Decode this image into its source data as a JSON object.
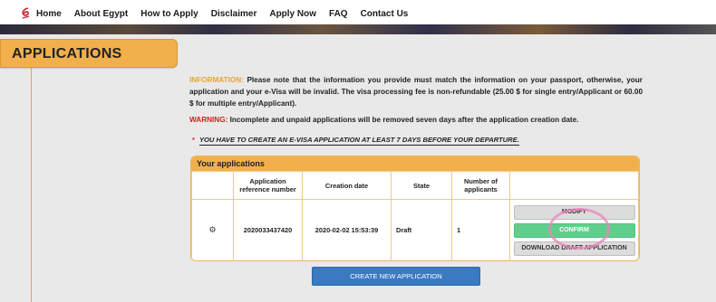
{
  "nav": {
    "items": [
      "Home",
      "About Egypt",
      "How to Apply",
      "Disclaimer",
      "Apply Now",
      "FAQ",
      "Contact Us"
    ]
  },
  "page": {
    "title": "APPLICATIONS"
  },
  "info": {
    "label": "INFORMATION:",
    "text": "Please note that the information you provide must match the information on your passport, otherwise, your application and your e-Visa will be invalid. The visa processing fee is non-refundable (25.00 $ for single entry/Applicant or 60.00 $ for multiple entry/Applicant)."
  },
  "warning": {
    "label": "WARNING:",
    "text": "Incomplete and unpaid applications will be removed seven days after the application creation date."
  },
  "notice": {
    "star": "*",
    "text": "YOU HAVE TO CREATE AN E-VISA APPLICATION AT LEAST 7 DAYS BEFORE YOUR DEPARTURE."
  },
  "panel": {
    "title": "Your applications",
    "columns": [
      "",
      "Application reference number",
      "Creation date",
      "State",
      "Number of applicants",
      ""
    ],
    "rows": [
      {
        "reference": "2020033437420",
        "created": "2020-02-02 15:53:39",
        "state": "Draft",
        "applicants": "1",
        "actions": {
          "top": "MODIFY",
          "confirm": "CONFIRM",
          "download": "DOWNLOAD DRAFT APPLICATION"
        }
      }
    ]
  },
  "create_button": "CREATE NEW APPLICATION",
  "colors": {
    "accent": "#f1b04c",
    "confirm": "#5fd08c",
    "primary": "#3a7ac0",
    "warning": "#d21f1f"
  }
}
